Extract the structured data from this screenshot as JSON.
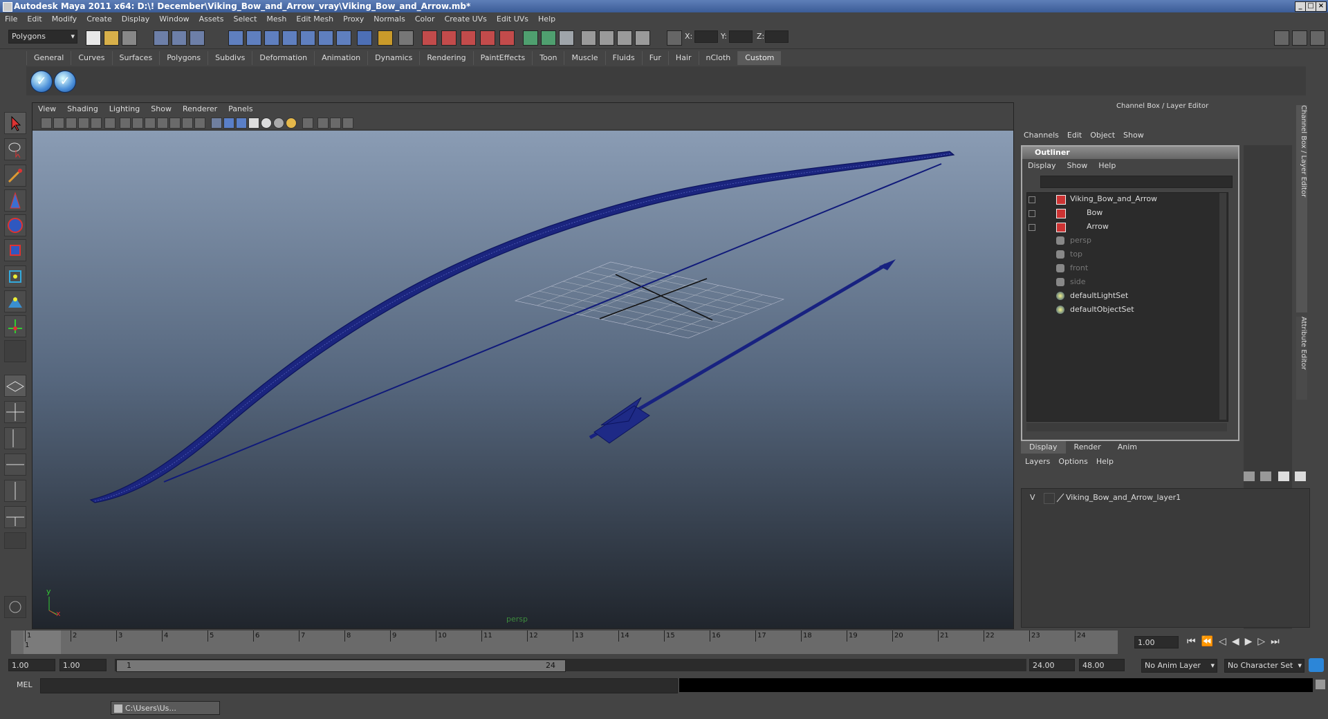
{
  "app": {
    "title": "Autodesk Maya 2011 x64: D:\\! December\\Viking_Bow_and_Arrow_vray\\Viking_Bow_and_Arrow.mb*"
  },
  "menubar": [
    "File",
    "Edit",
    "Modify",
    "Create",
    "Display",
    "Window",
    "Assets",
    "Select",
    "Mesh",
    "Edit Mesh",
    "Proxy",
    "Normals",
    "Color",
    "Create UVs",
    "Edit UVs",
    "Help"
  ],
  "statusline": {
    "mode": "Polygons",
    "x_label": "X:",
    "y_label": "Y:",
    "z_label": "Z:"
  },
  "shelf": {
    "tabs": [
      "General",
      "Curves",
      "Surfaces",
      "Polygons",
      "Subdivs",
      "Deformation",
      "Animation",
      "Dynamics",
      "Rendering",
      "PaintEffects",
      "Toon",
      "Muscle",
      "Fluids",
      "Fur",
      "Hair",
      "nCloth",
      "Custom"
    ],
    "active_tab": "Custom"
  },
  "viewport": {
    "menu": [
      "View",
      "Shading",
      "Lighting",
      "Show",
      "Renderer",
      "Panels"
    ],
    "camera_label": "persp",
    "axis_x": "x",
    "axis_y": "y"
  },
  "channel_box": {
    "title": "Channel Box / Layer Editor",
    "menu": [
      "Channels",
      "Edit",
      "Object",
      "Show"
    ],
    "side_tabs": [
      "Channel Box / Layer Editor",
      "Attribute Editor"
    ]
  },
  "outliner": {
    "title": "Outliner",
    "menu": [
      "Display",
      "Show",
      "Help"
    ],
    "items": [
      {
        "label": "Viking_Bow_and_Arrow",
        "kind": "transform",
        "dim": false
      },
      {
        "label": "Bow",
        "kind": "transform",
        "dim": false
      },
      {
        "label": "Arrow",
        "kind": "transform",
        "dim": false
      },
      {
        "label": "persp",
        "kind": "camera",
        "dim": true
      },
      {
        "label": "top",
        "kind": "camera",
        "dim": true
      },
      {
        "label": "front",
        "kind": "camera",
        "dim": true
      },
      {
        "label": "side",
        "kind": "camera",
        "dim": true
      },
      {
        "label": "defaultLightSet",
        "kind": "set",
        "dim": false
      },
      {
        "label": "defaultObjectSet",
        "kind": "set",
        "dim": false
      }
    ]
  },
  "layer_editor": {
    "tabs": [
      "Display",
      "Render",
      "Anim"
    ],
    "menu": [
      "Layers",
      "Options",
      "Help"
    ],
    "layer": {
      "visible": "V",
      "name": "Viking_Bow_and_Arrow_layer1"
    }
  },
  "timeline": {
    "ticks": [
      "1",
      "2",
      "3",
      "4",
      "5",
      "6",
      "7",
      "8",
      "9",
      "10",
      "11",
      "12",
      "13",
      "14",
      "15",
      "16",
      "17",
      "18",
      "19",
      "20",
      "21",
      "22",
      "23",
      "24"
    ],
    "current_frame": "1.00",
    "current_marker": "1"
  },
  "range": {
    "start": "1.00",
    "playback_start": "1.00",
    "slider_start": "1",
    "slider_end": "24",
    "playback_end": "24.00",
    "end": "48.00",
    "anim_layer": "No Anim Layer",
    "character_set": "No Character Set"
  },
  "command": {
    "label": "MEL"
  },
  "taskbar": {
    "item": "C:\\Users\\Us..."
  }
}
